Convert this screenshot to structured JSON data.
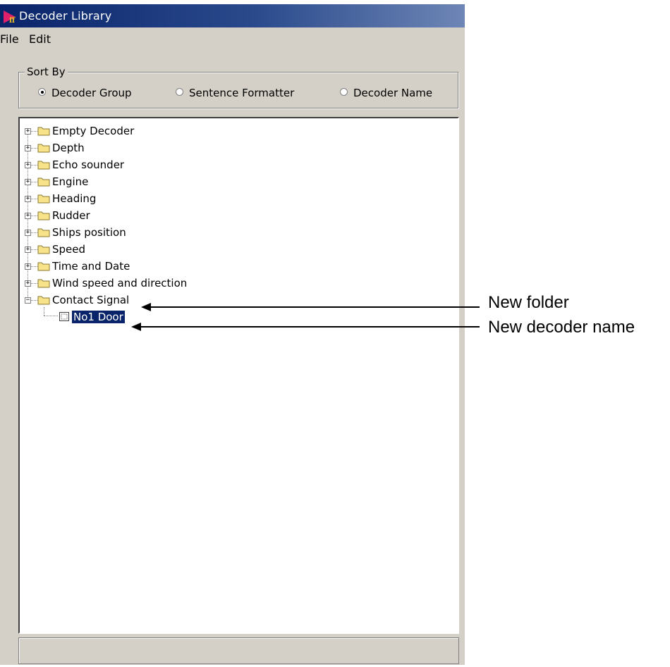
{
  "window": {
    "title": "Decoder Library",
    "menu": [
      "File",
      "Edit"
    ]
  },
  "sort_by": {
    "label": "Sort By",
    "options": [
      "Decoder Group",
      "Sentence Formatter",
      "Decoder Name"
    ],
    "selected": "Decoder Group"
  },
  "tree": {
    "items": [
      {
        "label": " Empty Decoder",
        "expanded": false
      },
      {
        "label": "Depth",
        "expanded": false
      },
      {
        "label": "Echo sounder",
        "expanded": false
      },
      {
        "label": "Engine",
        "expanded": false
      },
      {
        "label": "Heading",
        "expanded": false
      },
      {
        "label": "Rudder",
        "expanded": false
      },
      {
        "label": "Ships position",
        "expanded": false
      },
      {
        "label": "Speed",
        "expanded": false
      },
      {
        "label": "Time and Date",
        "expanded": false
      },
      {
        "label": "Wind speed and direction",
        "expanded": false
      },
      {
        "label": "Contact Signal",
        "expanded": true,
        "children": [
          {
            "label": "No1 Door",
            "selected": true
          }
        ]
      }
    ]
  },
  "annotations": {
    "new_folder": "New folder",
    "new_decoder_name": "New decoder name"
  },
  "colors": {
    "window_bg": "#d4d0c8",
    "titlebar": "#0a246a",
    "folder": "#f8e38a",
    "selection": "#0a246a"
  }
}
